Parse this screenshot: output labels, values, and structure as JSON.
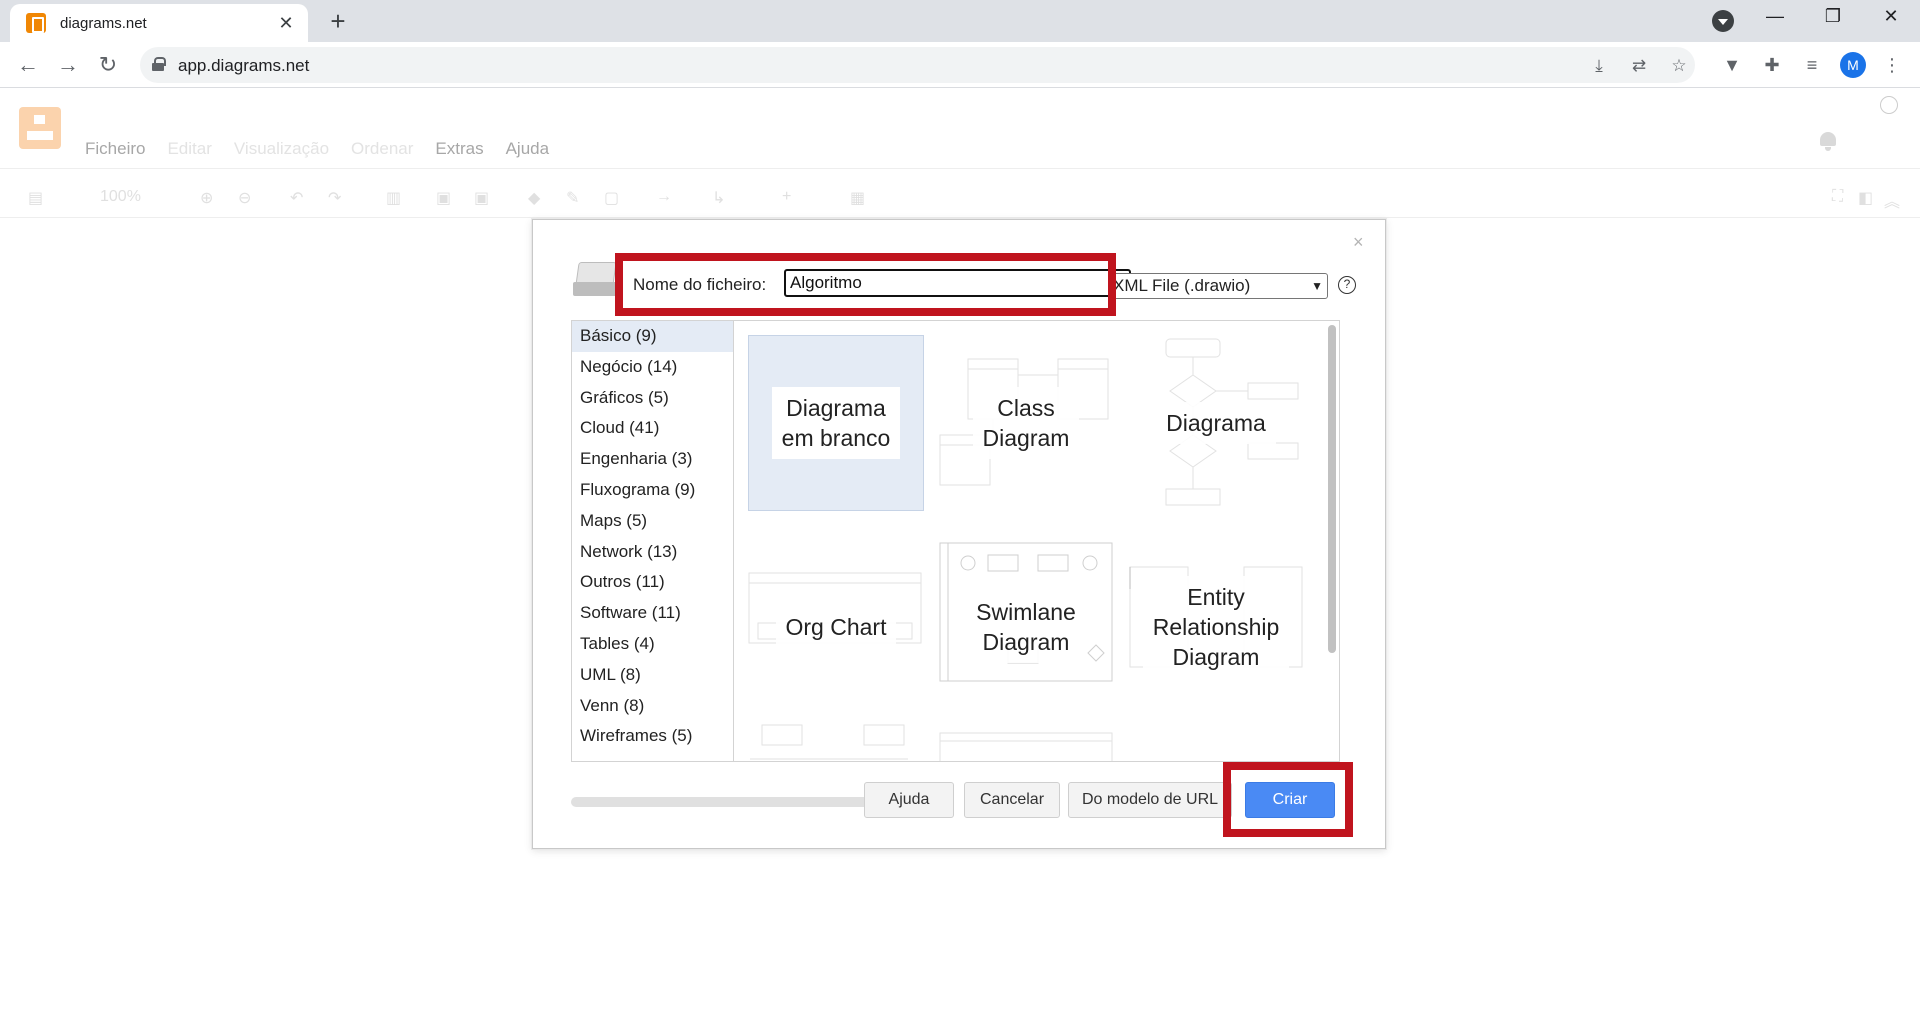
{
  "browser": {
    "tab_title": "diagrams.net",
    "tab_close": "✕",
    "new_tab": "+",
    "url": "app.diagrams.net",
    "profile_initial": "M",
    "window_controls": [
      "—",
      "❐",
      "✕"
    ]
  },
  "app": {
    "menu": [
      "Ficheiro",
      "Editar",
      "Visualização",
      "Ordenar",
      "Extras",
      "Ajuda"
    ],
    "zoom": "100%"
  },
  "dialog": {
    "close": "×",
    "filename_label": "Nome do ficheiro:",
    "filename_value": "Algoritmo",
    "format": "XML File (.drawio)",
    "help_icon": "?",
    "categories": [
      "Básico (9)",
      "Negócio (14)",
      "Gráficos (5)",
      "Cloud (41)",
      "Engenharia (3)",
      "Fluxograma (9)",
      "Maps (5)",
      "Network (13)",
      "Outros (11)",
      "Software (11)",
      "Tables (4)",
      "UML (8)",
      "Venn (8)",
      "Wireframes (5)"
    ],
    "selected_category": "Básico (9)",
    "templates": [
      {
        "label": "Diagrama\nem branco",
        "selected": true
      },
      {
        "label": "Class\nDiagram"
      },
      {
        "label": "Diagrama"
      },
      {
        "label": "Org Chart"
      },
      {
        "label": "Swimlane\nDiagram"
      },
      {
        "label": "Entity\nRelationship\nDiagram"
      }
    ],
    "buttons": {
      "help": "Ajuda",
      "cancel": "Cancelar",
      "from_url": "Do modelo de URL",
      "create": "Criar"
    }
  },
  "colors": {
    "highlight": "#c0141e",
    "primary_button": "#4a8af4",
    "selection": "#e4ebf5"
  }
}
